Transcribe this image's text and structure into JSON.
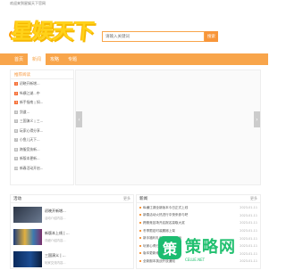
{
  "topbar": {
    "text": "欢迎来到星娱天下官网"
  },
  "logo": {
    "text": "星娱天下"
  },
  "search": {
    "placeholder": "请输入关键词",
    "button": "搜索"
  },
  "nav": {
    "items": [
      "首页",
      "新闻",
      "攻略",
      "专题"
    ],
    "active_index": 1
  },
  "recommend": {
    "title": "推荐阅读",
    "items": [
      {
        "num": "1",
        "text": "初晓开新增..."
      },
      {
        "num": "2",
        "text": "纵横江湖...中"
      },
      {
        "num": "3",
        "text": "新手指南 | 如..."
      },
      {
        "num": "4",
        "text": "剑道..."
      },
      {
        "num": "5",
        "text": "三国演义 | 三..."
      },
      {
        "num": "6",
        "text": "玩家心得分享..."
      },
      {
        "num": "7",
        "text": "小鱼儿天下..."
      },
      {
        "num": "8",
        "text": "跨服竞技新..."
      },
      {
        "num": "9",
        "text": "新版本更新..."
      },
      {
        "num": "10",
        "text": "新春活动开启..."
      }
    ]
  },
  "banner": {
    "prev": "‹",
    "next": "›"
  },
  "left_panel": {
    "title": "活动",
    "more": "更多",
    "articles": [
      {
        "title": "初晓开新增...",
        "desc": "活动介绍内容..."
      },
      {
        "title": "新版本上线 | ...",
        "desc": "详细介绍内容..."
      },
      {
        "title": "三国演义 | ...",
        "desc": "玩家交流内容..."
      }
    ]
  },
  "right_panel": {
    "title": "新闻",
    "more": "更多",
    "items": [
      {
        "text": "纵横江湖全新版本今日正式上线",
        "date": "2023-01-11"
      },
      {
        "text": "新春活动火热进行中快来参与吧",
        "date": "2023-01-11"
      },
      {
        "text": "跨服竞技场开启报名赢取大奖",
        "date": "2023-01-11"
      },
      {
        "text": "冬季限定时装震撼上架",
        "date": "2023-01-11"
      },
      {
        "text": "新手福利礼包免费领取活动",
        "date": "2023-01-11"
      },
      {
        "text": "玩家心得分享精选内容合集",
        "date": "2023-01-11"
      },
      {
        "text": "版本更新维护公告说明",
        "date": "2023-01-11"
      },
      {
        "text": "全新副本挑战开放通知",
        "date": "2023-01-11"
      }
    ]
  },
  "watermark": {
    "big": "策略网",
    "small": "CELUE.NET",
    "icon": "策"
  }
}
